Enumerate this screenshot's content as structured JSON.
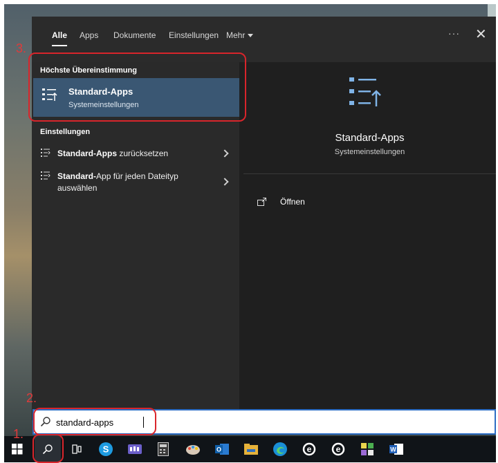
{
  "filter_bar": {
    "tabs": [
      {
        "label": "Alle",
        "active": true
      },
      {
        "label": "Apps",
        "active": false
      },
      {
        "label": "Dokumente",
        "active": false
      },
      {
        "label": "Einstellungen",
        "active": false
      },
      {
        "label": "Mehr",
        "active": false
      }
    ],
    "ellipsis": "···",
    "close": "✕"
  },
  "results": {
    "best_match_header": "Höchste Übereinstimmung",
    "best_match": {
      "title": "Standard-Apps",
      "subtitle": "Systemeinstellungen",
      "icon": "default-apps-icon"
    },
    "settings_header": "Einstellungen",
    "settings_items": [
      {
        "bold": "Standard-Apps",
        "rest": " zurücksetzen",
        "icon": "settings-list-icon"
      },
      {
        "bold": "Standard-",
        "rest": "App für jeden Dateityp auswählen",
        "icon": "settings-list-icon"
      }
    ]
  },
  "preview": {
    "title": "Standard-Apps",
    "subtitle": "Systemeinstellungen",
    "open_label": "Öffnen"
  },
  "search": {
    "value": "standard-apps"
  },
  "taskbar": {
    "items": [
      "windows-start-icon",
      "search-icon",
      "task-view-icon",
      "skype-icon",
      "teams-icon",
      "calculator-icon",
      "paint-icon",
      "outlook-icon",
      "file-explorer-icon",
      "edge-icon",
      "internet-explorer-icon",
      "internet-explorer-icon",
      "app-icon",
      "word-icon"
    ]
  },
  "annotations": [
    "1.",
    "2.",
    "3."
  ],
  "colors": {
    "accent": "#3a5773",
    "annotation": "#d9252b",
    "search_border": "#2b6cc4"
  }
}
